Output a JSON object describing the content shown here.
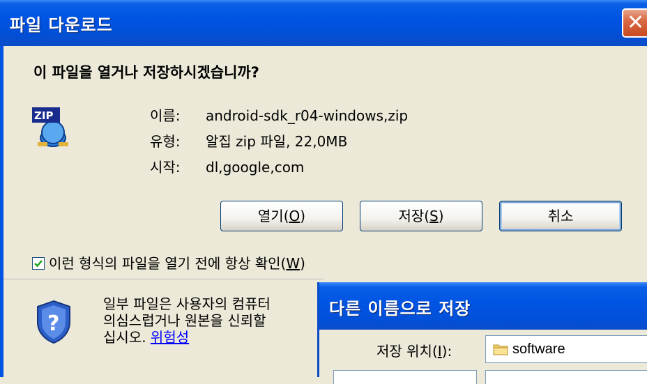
{
  "download_dialog": {
    "title": "파일 다운로드",
    "question": "이 파일을 열거나 저장하시겠습니까?",
    "file_icon": "zip-file-icon",
    "name_label": "이름:",
    "name_value": "android-sdk_r04-windows,zip",
    "type_label": "유형:",
    "type_value": "알집 zip 파일, 22,0MB",
    "from_label": "시작:",
    "from_value": "dl,google,com",
    "buttons": {
      "open_prefix": "열기(",
      "open_key": "O",
      "save_prefix": "저장(",
      "save_key": "S",
      "suffix": ")",
      "cancel": "취소"
    },
    "checkbox": {
      "checked": true,
      "label_prefix": "이런 형식의 파일을 열기 전에 항상 확인(",
      "label_key": "W",
      "label_suffix": ")"
    },
    "warning": {
      "line1": "일부 파일은 사용자의 컴퓨터",
      "line2": "의심스럽거나 원본을 신뢰할",
      "line3_prefix": "십시오. ",
      "risk_link": "위험성"
    },
    "colors": {
      "titlebar": "#0054E3",
      "dialog_bg": "#ECE9D8",
      "close": "#D96A45"
    }
  },
  "save_as_dialog": {
    "title": "다른 이름으로 저장",
    "location_prefix": "저장 위치(",
    "location_key": "I",
    "location_suffix": "):",
    "location_value": "software"
  }
}
